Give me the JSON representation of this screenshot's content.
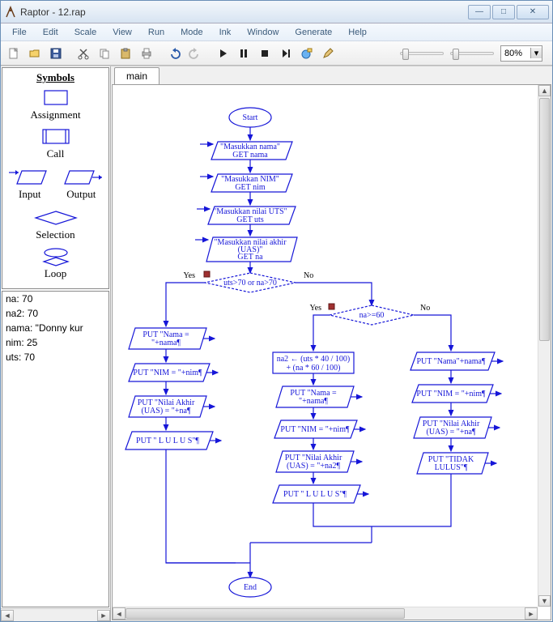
{
  "window": {
    "title": "Raptor - 12.rap"
  },
  "winbtns": {
    "min": "—",
    "max": "□",
    "close": "✕"
  },
  "menu": {
    "items": [
      "File",
      "Edit",
      "Scale",
      "View",
      "Run",
      "Mode",
      "Ink",
      "Window",
      "Generate",
      "Help"
    ]
  },
  "toolbar": {
    "items": [
      {
        "name": "new",
        "title": "New"
      },
      {
        "name": "open",
        "title": "Open"
      },
      {
        "name": "save",
        "title": "Save"
      },
      {
        "name": "cut",
        "title": "Cut"
      },
      {
        "name": "copy",
        "title": "Copy"
      },
      {
        "name": "paste",
        "title": "Paste"
      },
      {
        "name": "print",
        "title": "Print"
      },
      {
        "name": "undo",
        "title": "Undo"
      },
      {
        "name": "redo",
        "title": "Redo"
      },
      {
        "name": "play",
        "title": "Play"
      },
      {
        "name": "pause",
        "title": "Pause"
      },
      {
        "name": "stop",
        "title": "Stop"
      },
      {
        "name": "step",
        "title": "Step"
      },
      {
        "name": "breakpoint",
        "title": "Toggle Breakpoint"
      },
      {
        "name": "pen",
        "title": "Pen"
      }
    ]
  },
  "zoom": {
    "value": "80%"
  },
  "sidebar": {
    "title": "Symbols",
    "symbols": [
      {
        "name": "assignment",
        "label": "Assignment"
      },
      {
        "name": "call",
        "label": "Call"
      },
      {
        "name": "input",
        "label": "Input"
      },
      {
        "name": "output",
        "label": "Output"
      },
      {
        "name": "selection",
        "label": "Selection"
      },
      {
        "name": "loop",
        "label": "Loop"
      }
    ]
  },
  "variables": [
    {
      "text": "na: 70"
    },
    {
      "text": "na2: 70"
    },
    {
      "text": "nama: \"Donny kur"
    },
    {
      "text": "nim: 25"
    },
    {
      "text": "uts: 70"
    }
  ],
  "tabs": {
    "main": "main"
  },
  "flow": {
    "start": "Start",
    "end": "End",
    "in1a": "\"Masukkan nama\"",
    "in1b": "GET nama",
    "in2a": "\"Masukkan NIM\"",
    "in2b": "GET nim",
    "in3a": "\"Masukkan nilai UTS\"",
    "in3b": "GET uts",
    "in4a": "\"Masukkan nilai akhir",
    "in4b": "(UAS)\"",
    "in4c": "GET na",
    "cond1": "uts>70 or na>70",
    "cond2": "na>=60",
    "yes": "Yes",
    "no": "No",
    "l1a": "PUT \"Nama =",
    "l1b": "\"+nama¶",
    "l2": "PUT \"NIM = \"+nim¶",
    "l3a": "PUT \"Nilai Akhir",
    "l3b": "(UAS) = \"+na¶",
    "l4": "PUT \"   L U L U S\"¶",
    "m0a": "na2 ← (uts * 40 / 100)",
    "m0b": "+ (na * 60 / 100)",
    "m1a": "PUT \"Nama =",
    "m1b": "\"+nama¶",
    "m2": "PUT \"NIM = \"+nim¶",
    "m3a": "PUT \"Nilai Akhir",
    "m3b": "(UAS) = \"+na2¶",
    "m4": "PUT \"   L U L U S\"¶",
    "r1": "PUT \"Nama\"+nama¶",
    "r2": "PUT \"NIM = \"+nim¶",
    "r3a": "PUT \"Nilai Akhir",
    "r3b": "(UAS) = \"+na¶",
    "r4a": "PUT \"TIDAK",
    "r4b": "LULUS\"¶"
  }
}
